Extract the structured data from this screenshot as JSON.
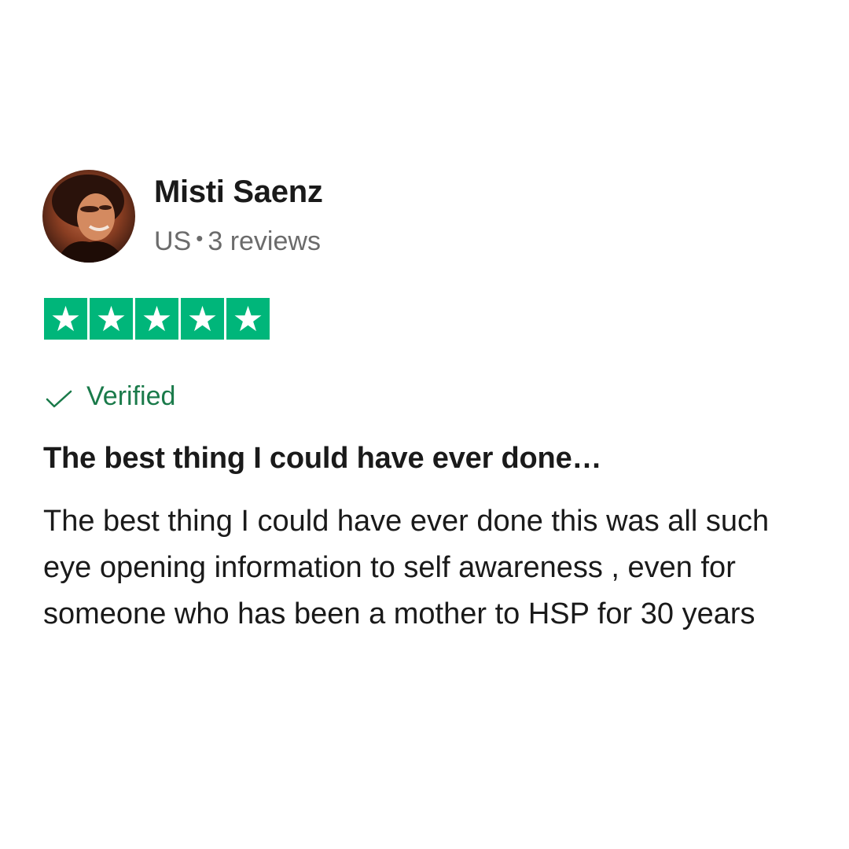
{
  "reviewer": {
    "name": "Misti Saenz",
    "country": "US",
    "separator": "•",
    "review_count": "3 reviews",
    "avatar_icon": "user-photo-avatar"
  },
  "rating": {
    "stars": 5,
    "max_stars": 5,
    "color": "#00b67a",
    "star_icon": "star-icon"
  },
  "verified": {
    "label": "Verified",
    "color": "#1a7a4a",
    "icon": "checkmark-icon"
  },
  "review": {
    "title": "The best thing I could have ever done…",
    "body": "The best thing I could have ever done this was all such eye opening information to self awareness , even for someone who has been a mother to HSP for 30 years"
  }
}
